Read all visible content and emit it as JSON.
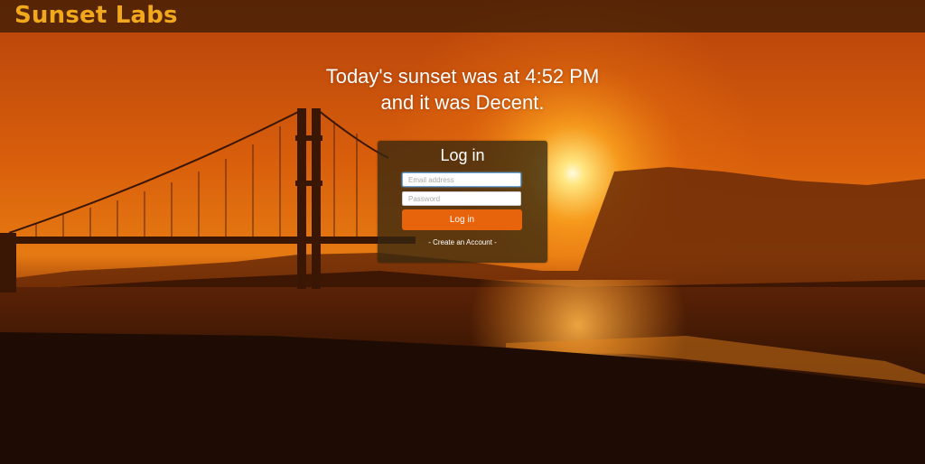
{
  "header": {
    "brand": "Sunset Labs"
  },
  "headline": {
    "line1": "Today's sunset was at 4:52 PM",
    "line2": "and it was Decent."
  },
  "login": {
    "title": "Log in",
    "email_placeholder": "Email address",
    "email_value": "",
    "password_placeholder": "Password",
    "password_value": "",
    "submit_label": "Log in",
    "create_account_link": "- Create an Account -"
  },
  "colors": {
    "brand": "#f2a81d",
    "accent": "#e8640c"
  },
  "icons": {
    "background": "golden-gate-bridge-sunset-photo"
  }
}
